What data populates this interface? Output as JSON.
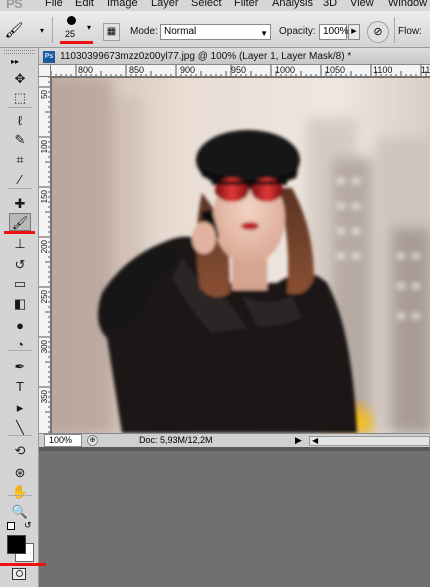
{
  "menubar": {
    "logo": "PS",
    "items": [
      "File",
      "Edit",
      "Image",
      "Layer",
      "Select",
      "Filter",
      "Analysis",
      "3D",
      "View",
      "Window"
    ]
  },
  "options": {
    "brush_size": "25",
    "mode_label": "Mode:",
    "mode_value": "Normal",
    "opacity_label": "Opacity:",
    "opacity_value": "100%",
    "flow_label": "Flow:"
  },
  "document": {
    "tab_badge": "Ps",
    "tab_title": "11030399673mzz0z00yl77.jpg @ 100% (Layer 1, Layer Mask/8) *",
    "ruler_top": [
      "800",
      "850",
      "900",
      "950",
      "1000",
      "1050",
      "1100",
      "1150"
    ],
    "ruler_left": [
      "50",
      "100",
      "150",
      "200",
      "250",
      "300",
      "350"
    ]
  },
  "status": {
    "zoom": "100%",
    "doc_info": "Doc: 5,93M/12,2M"
  },
  "colors": {
    "highlight_red": "#e11111",
    "foreground": "#000000",
    "background": "#ffffff"
  },
  "tools": [
    {
      "name": "move-icon",
      "glyph": "✥"
    },
    {
      "name": "marquee-icon",
      "glyph": "⬚"
    },
    {
      "name": "lasso-icon",
      "glyph": "ℓ"
    },
    {
      "name": "quick-select-icon",
      "glyph": "✎"
    },
    {
      "name": "crop-icon",
      "glyph": "⌗"
    },
    {
      "name": "eyedropper-icon",
      "glyph": "⁄"
    },
    {
      "name": "healing-brush-icon",
      "glyph": "✚"
    },
    {
      "name": "brush-icon",
      "glyph": "🖌"
    },
    {
      "name": "clone-stamp-icon",
      "glyph": "⊥"
    },
    {
      "name": "history-brush-icon",
      "glyph": "↺"
    },
    {
      "name": "eraser-icon",
      "glyph": "▭"
    },
    {
      "name": "gradient-icon",
      "glyph": "◧"
    },
    {
      "name": "blur-icon",
      "glyph": "●"
    },
    {
      "name": "dodge-icon",
      "glyph": "◔"
    },
    {
      "name": "pen-icon",
      "glyph": "✒"
    },
    {
      "name": "type-icon",
      "glyph": "T"
    },
    {
      "name": "path-select-icon",
      "glyph": "▸"
    },
    {
      "name": "shape-icon",
      "glyph": "╲"
    },
    {
      "name": "3d-rotate-icon",
      "glyph": "⟲"
    },
    {
      "name": "3d-orbit-icon",
      "glyph": "⊛"
    },
    {
      "name": "hand-icon",
      "glyph": "✋"
    },
    {
      "name": "zoom-icon",
      "glyph": "🔍"
    }
  ]
}
